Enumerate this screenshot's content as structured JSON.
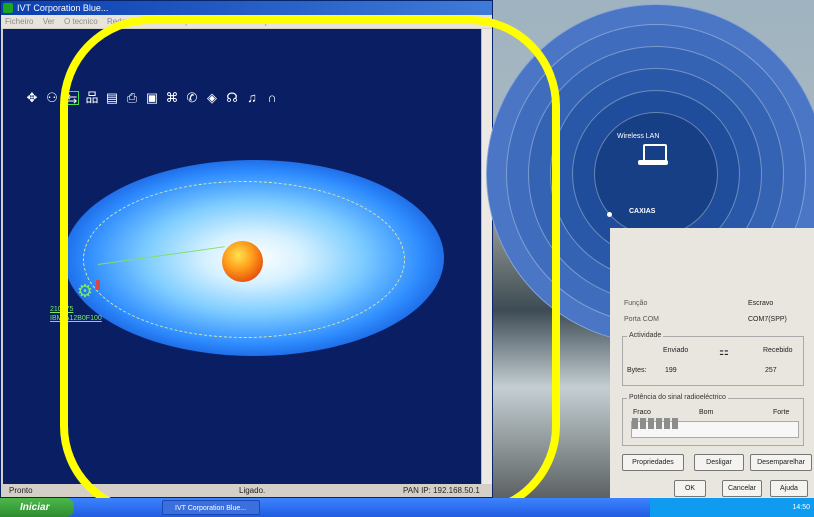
{
  "window": {
    "title": "IVT Corporation Blue...",
    "menu": [
      "Ficheiro",
      "Ver",
      "O tecnico",
      "Rede",
      "Os seus serviços",
      "Ferramentas",
      "Ajuda"
    ]
  },
  "toolbar": {
    "icons": [
      "hub-icon",
      "pair-icon",
      "network-active-icon",
      "lan-icon",
      "file-icon",
      "printer-icon",
      "serial-icon",
      "fax-icon",
      "dialup-icon",
      "camera-icon",
      "headset-icon",
      "audio-icon",
      "headphones-icon"
    ]
  },
  "map": {
    "device_label_1": "210775",
    "device_label_2": "IBM-A12B0F100"
  },
  "status": {
    "left": "Pronto",
    "center": "Ligado.",
    "right": "PAN IP: 192.168.50.1"
  },
  "overlay": {
    "title": "Wireless LAN",
    "node_label": "CAXIAS"
  },
  "properties": {
    "rows": [
      {
        "k": "Função",
        "v": "Escravo"
      },
      {
        "k": "Porta COM",
        "v": "COM7(SPP)"
      }
    ],
    "activity": {
      "title": "Actividade",
      "sent_label": "Enviado",
      "received_label": "Recebido",
      "bytes_label": "Bytes:",
      "sent_value": "199",
      "received_value": "257"
    },
    "signal": {
      "title": "Potência do sinal radioeléctrico",
      "weak": "Fraco",
      "good": "Bom",
      "strong": "Forte",
      "level_bars": 6
    },
    "buttons": {
      "properties": "Propriedades",
      "disconnect": "Desligar",
      "unpair": "Desemparelhar",
      "ok": "OK",
      "cancel": "Cancelar",
      "help": "Ajuda"
    }
  },
  "taskbar": {
    "start": "Iniciar",
    "task": "IVT Corporation Blue...",
    "clock": "14:50"
  }
}
